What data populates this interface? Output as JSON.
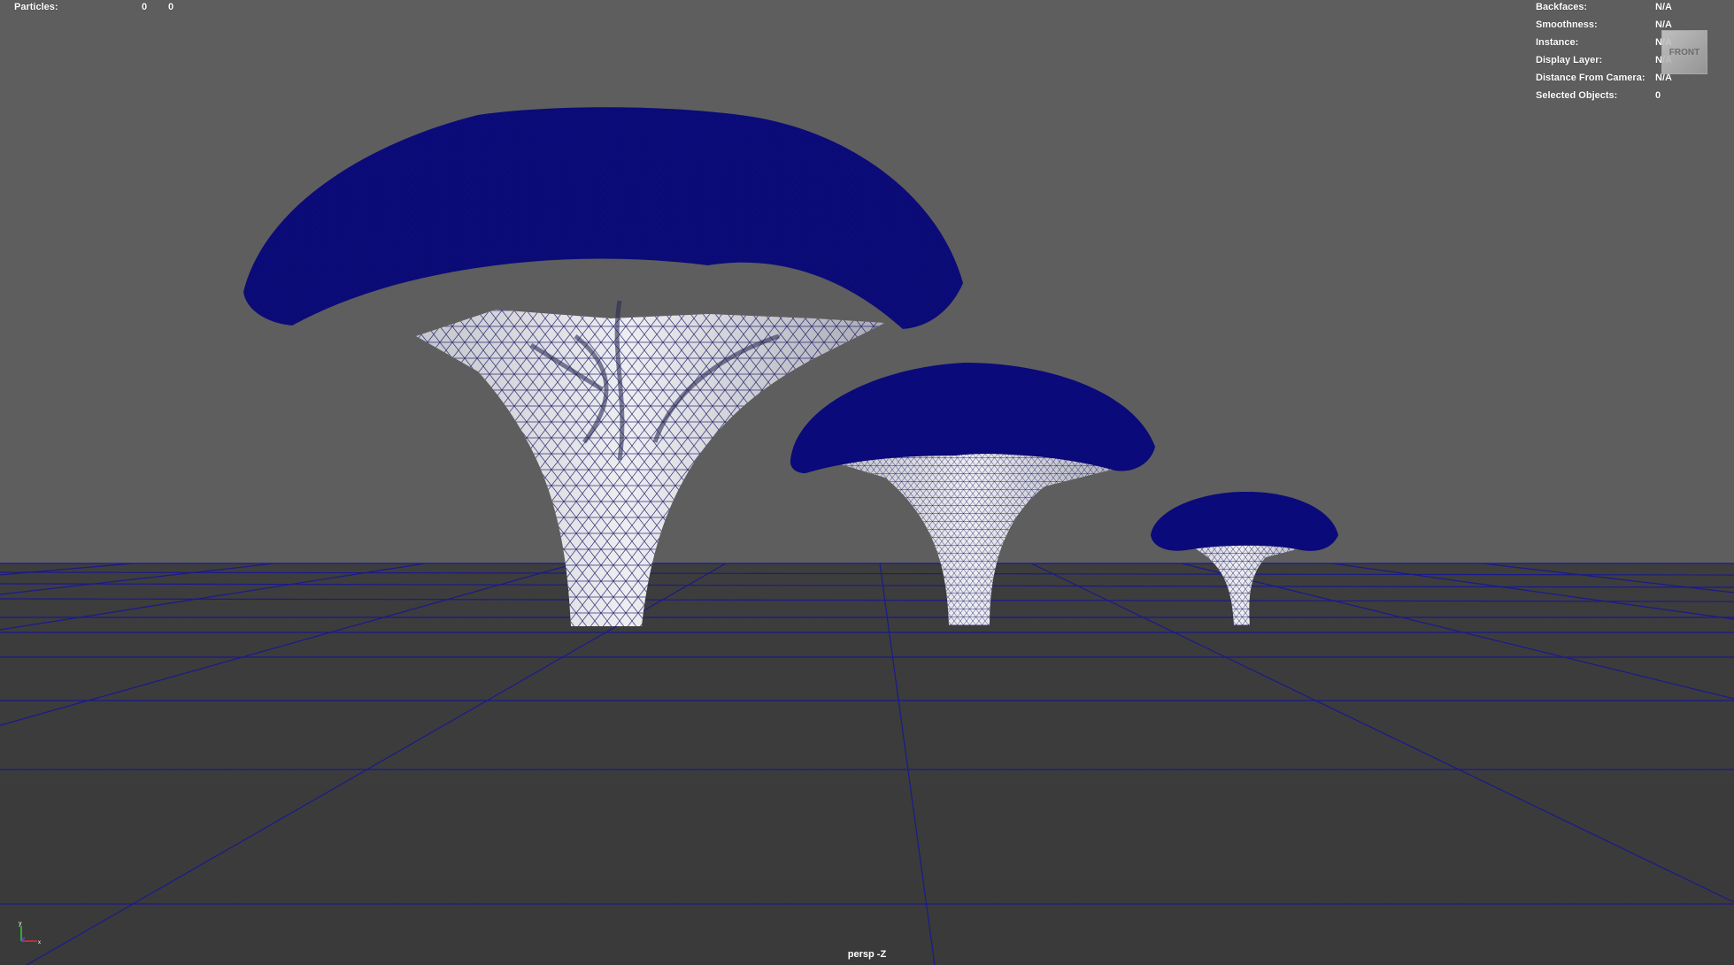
{
  "hud_left": {
    "label": "Particles:",
    "value_1": "0",
    "value_2": "0"
  },
  "hud_right": [
    {
      "label": "Backfaces:",
      "value": "N/A"
    },
    {
      "label": "Smoothness:",
      "value": "N/A"
    },
    {
      "label": "Instance:",
      "value": "N/A"
    },
    {
      "label": "Display Layer:",
      "value": "N/A"
    },
    {
      "label": "Distance From Camera:",
      "value": "N/A"
    },
    {
      "label": "Selected Objects:",
      "value": "0"
    }
  ],
  "view_cube": {
    "face": "FRONT"
  },
  "camera": {
    "label": "persp -Z"
  },
  "axis_gizmo": {
    "y": "y",
    "x": "x"
  },
  "colors": {
    "background_upper": "#5e5e5e",
    "background_lower": "#3b3b3b",
    "grid_line": "#1a1a8c",
    "foliage": "#0a0a7a",
    "trunk": "#d8d8e0",
    "wireframe": "#141464"
  }
}
